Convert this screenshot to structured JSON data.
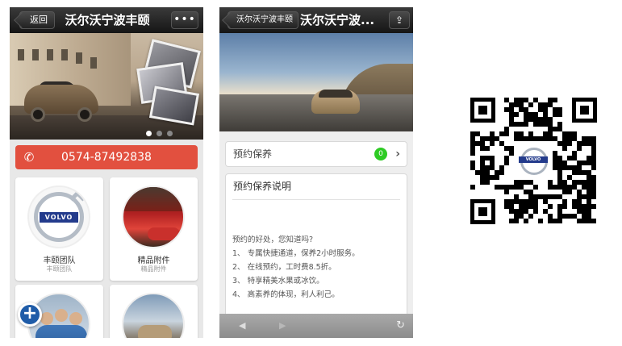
{
  "phone1": {
    "nav": {
      "back_label": "返回",
      "title": "沃尔沃宁波丰颐",
      "more_label": "•••"
    },
    "carousel": {
      "active_index": 0,
      "count": 3
    },
    "phone_number": "0574-87492838",
    "tiles": [
      {
        "title": "丰颐团队",
        "subtitle": "丰颐团队",
        "image": "volvo-logo"
      },
      {
        "title": "精品附件",
        "subtitle": "精品附件",
        "image": "red-car-photo"
      },
      {
        "title": "",
        "subtitle": "",
        "image": "staff-photo"
      },
      {
        "title": "",
        "subtitle": "",
        "image": "car-photo"
      }
    ],
    "plus_label": "+"
  },
  "phone2": {
    "nav": {
      "back_label": "沃尔沃宁波丰颐",
      "title": "沃尔沃宁波..."
    },
    "booking": {
      "label": "预约保养",
      "badge_count": "0"
    },
    "info": {
      "title": "预约保养说明",
      "lines": [
        "预约的好处，您知道吗?",
        "1、 专属快捷通道，保养2小时服务。",
        "2、 在线预约，工时费8.5折。",
        "3、 特享精美水果或冰饮。",
        "4、 高素养的体现，利人利己。"
      ]
    },
    "browser_bar": {
      "back": "◀",
      "forward": "▶",
      "refresh": "↻"
    }
  },
  "qr": {
    "logo_text": "VOLVO"
  },
  "logo_text": "VOLVO",
  "colors": {
    "accent_red": "#e2503f",
    "badge_green": "#2ecb24",
    "volvo_blue": "#233b8c"
  }
}
